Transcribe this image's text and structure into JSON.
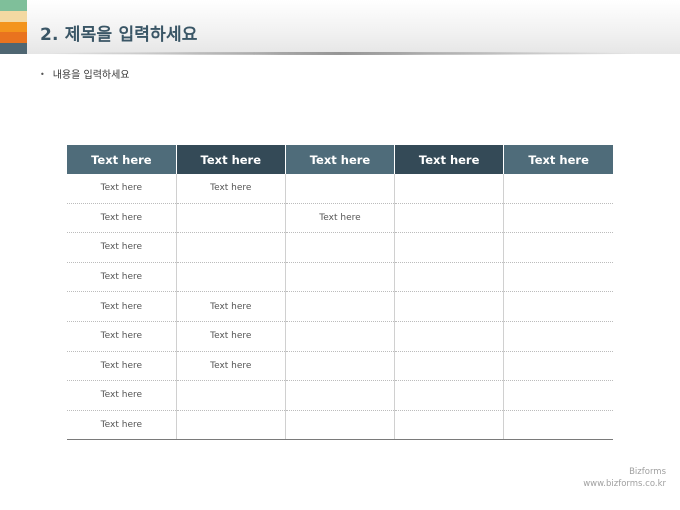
{
  "slide": {
    "title": "2. 제목을 입력하세요",
    "bullet": "내용을 입력하세요"
  },
  "decor": {
    "stripes": [
      "#7fbf9a",
      "#f3d9a2",
      "#f3941c",
      "#e9731f",
      "#4f6672"
    ]
  },
  "table": {
    "header_colors": [
      "#4f6c7a",
      "#344a57",
      "#4f6c7a",
      "#344a57",
      "#4f6c7a"
    ],
    "headers": [
      "Text here",
      "Text here",
      "Text here",
      "Text here",
      "Text here"
    ],
    "rows": [
      [
        "Text here",
        "Text here",
        "",
        "",
        ""
      ],
      [
        "Text here",
        "",
        "Text here",
        "",
        ""
      ],
      [
        "Text here",
        "",
        "",
        "",
        ""
      ],
      [
        "Text here",
        "",
        "",
        "",
        ""
      ],
      [
        "Text here",
        "Text here",
        "",
        "",
        ""
      ],
      [
        "Text here",
        "Text here",
        "",
        "",
        ""
      ],
      [
        "Text here",
        "Text here",
        "",
        "",
        ""
      ],
      [
        "Text here",
        "",
        "",
        "",
        ""
      ],
      [
        "Text here",
        "",
        "",
        "",
        ""
      ]
    ]
  },
  "footer": {
    "brand_name": "Bizforms",
    "brand_url": "www.bizforms.co.kr"
  }
}
